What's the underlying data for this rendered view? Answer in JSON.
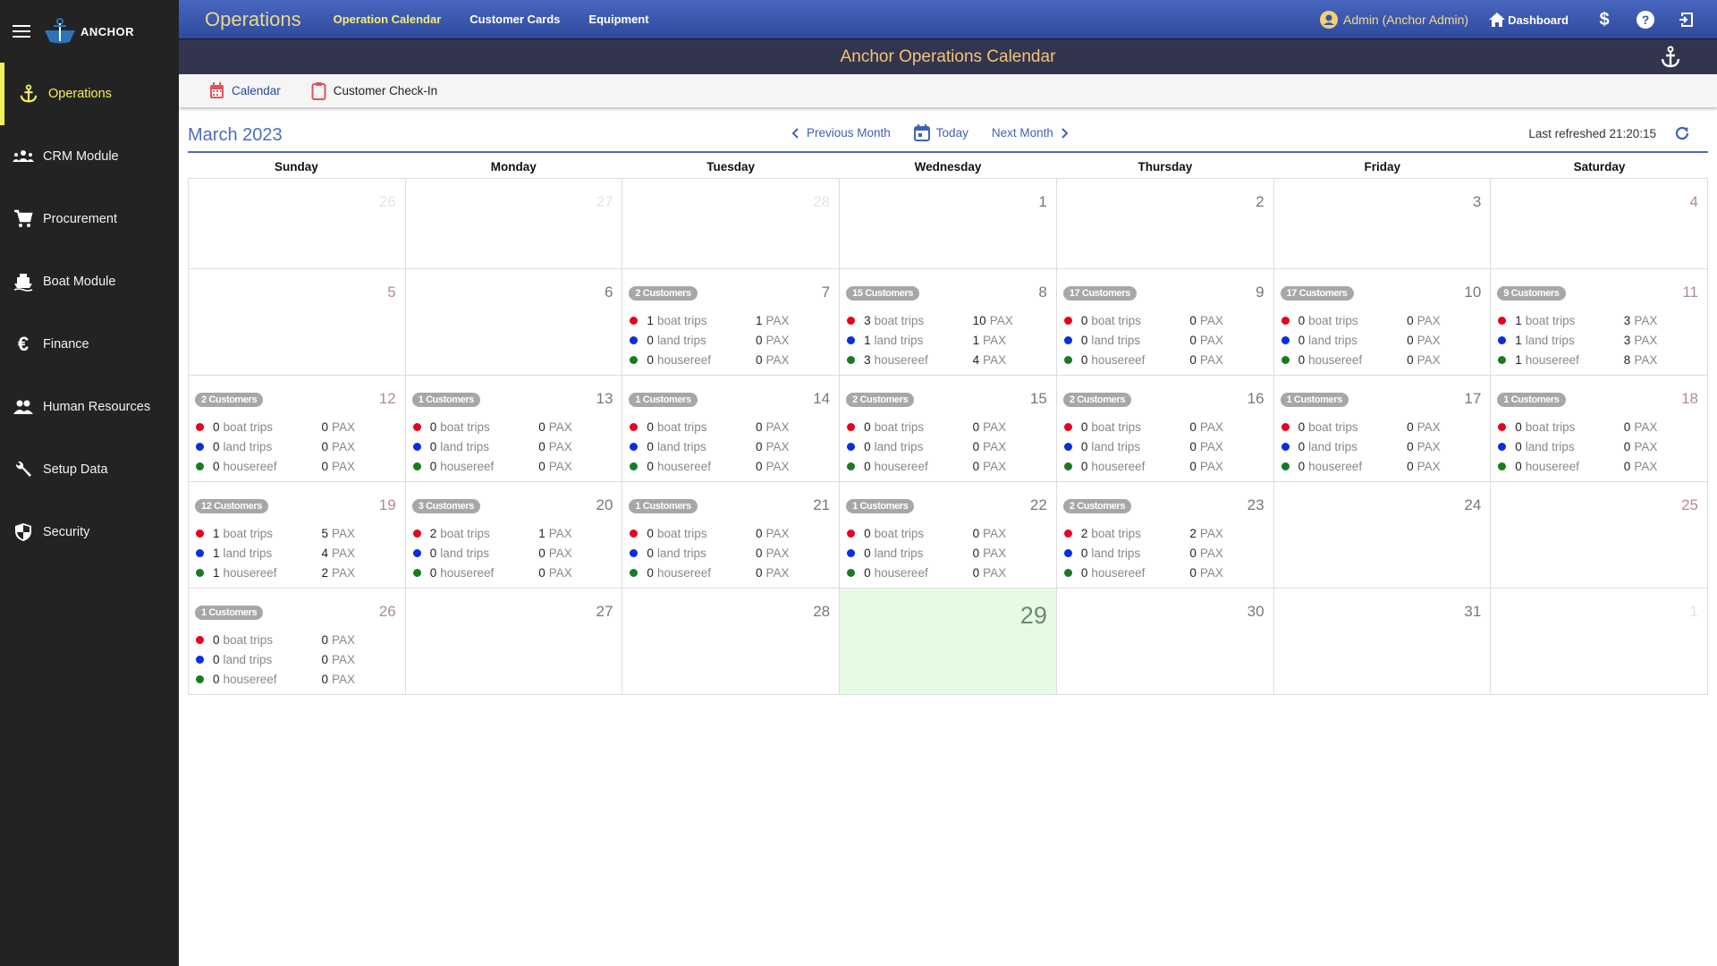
{
  "sidebar": {
    "logo_text": "ANCHOR",
    "items": [
      {
        "label": "Operations",
        "icon": "anchor-icon",
        "active": true
      },
      {
        "label": "CRM Module",
        "icon": "groups-icon"
      },
      {
        "label": "Procurement",
        "icon": "cart-icon"
      },
      {
        "label": "Boat Module",
        "icon": "boat-icon"
      },
      {
        "label": "Finance",
        "icon": "euro-icon"
      },
      {
        "label": "Human Resources",
        "icon": "people-icon"
      },
      {
        "label": "Setup Data",
        "icon": "wrench-icon"
      },
      {
        "label": "Security",
        "icon": "shield-icon"
      }
    ]
  },
  "topbar": {
    "title": "Operations",
    "links": [
      "Operation Calendar",
      "Customer Cards",
      "Equipment"
    ],
    "user": "Admin (Anchor Admin)",
    "dashboard": "Dashboard"
  },
  "subbar": {
    "title": "Anchor Operations Calendar"
  },
  "tabs": [
    "Calendar",
    "Customer Check-In"
  ],
  "calendar": {
    "month_label": "March 2023",
    "prev": "Previous Month",
    "today": "Today",
    "next": "Next Month",
    "refreshed": "Last refreshed 21:20:15",
    "weekdays": [
      "Sunday",
      "Monday",
      "Tuesday",
      "Wednesday",
      "Thursday",
      "Friday",
      "Saturday"
    ],
    "stat_labels": [
      "boat trips",
      "land trips",
      "housereef"
    ],
    "pax_label": "PAX",
    "dot_colors": [
      "#e8001c",
      "#0a2de0",
      "#1a7a22"
    ],
    "weeks": [
      [
        {
          "day": "26",
          "other": true,
          "weekend": true
        },
        {
          "day": "27",
          "other": true
        },
        {
          "day": "28",
          "other": true
        },
        {
          "day": "1"
        },
        {
          "day": "2"
        },
        {
          "day": "3"
        },
        {
          "day": "4",
          "weekend": true
        }
      ],
      [
        {
          "day": "5",
          "weekend": true
        },
        {
          "day": "6"
        },
        {
          "day": "7",
          "customers": "2 Customers",
          "stats": [
            [
              1,
              1
            ],
            [
              0,
              0
            ],
            [
              0,
              0
            ]
          ]
        },
        {
          "day": "8",
          "customers": "15 Customers",
          "stats": [
            [
              3,
              10
            ],
            [
              1,
              1
            ],
            [
              3,
              4
            ]
          ]
        },
        {
          "day": "9",
          "customers": "17 Customers",
          "stats": [
            [
              0,
              0
            ],
            [
              0,
              0
            ],
            [
              0,
              0
            ]
          ]
        },
        {
          "day": "10",
          "customers": "17 Customers",
          "stats": [
            [
              0,
              0
            ],
            [
              0,
              0
            ],
            [
              0,
              0
            ]
          ]
        },
        {
          "day": "11",
          "weekend": true,
          "customers": "9 Customers",
          "stats": [
            [
              1,
              3
            ],
            [
              1,
              3
            ],
            [
              1,
              8
            ]
          ]
        }
      ],
      [
        {
          "day": "12",
          "weekend": true,
          "customers": "2 Customers",
          "stats": [
            [
              0,
              0
            ],
            [
              0,
              0
            ],
            [
              0,
              0
            ]
          ]
        },
        {
          "day": "13",
          "customers": "1 Customers",
          "stats": [
            [
              0,
              0
            ],
            [
              0,
              0
            ],
            [
              0,
              0
            ]
          ]
        },
        {
          "day": "14",
          "customers": "1 Customers",
          "stats": [
            [
              0,
              0
            ],
            [
              0,
              0
            ],
            [
              0,
              0
            ]
          ]
        },
        {
          "day": "15",
          "customers": "2 Customers",
          "stats": [
            [
              0,
              0
            ],
            [
              0,
              0
            ],
            [
              0,
              0
            ]
          ]
        },
        {
          "day": "16",
          "customers": "2 Customers",
          "stats": [
            [
              0,
              0
            ],
            [
              0,
              0
            ],
            [
              0,
              0
            ]
          ]
        },
        {
          "day": "17",
          "customers": "1 Customers",
          "stats": [
            [
              0,
              0
            ],
            [
              0,
              0
            ],
            [
              0,
              0
            ]
          ]
        },
        {
          "day": "18",
          "weekend": true,
          "customers": "1 Customers",
          "stats": [
            [
              0,
              0
            ],
            [
              0,
              0
            ],
            [
              0,
              0
            ]
          ]
        }
      ],
      [
        {
          "day": "19",
          "weekend": true,
          "customers": "12 Customers",
          "stats": [
            [
              1,
              5
            ],
            [
              1,
              4
            ],
            [
              1,
              2
            ]
          ]
        },
        {
          "day": "20",
          "customers": "3 Customers",
          "stats": [
            [
              2,
              1
            ],
            [
              0,
              0
            ],
            [
              0,
              0
            ]
          ]
        },
        {
          "day": "21",
          "customers": "1 Customers",
          "stats": [
            [
              0,
              0
            ],
            [
              0,
              0
            ],
            [
              0,
              0
            ]
          ]
        },
        {
          "day": "22",
          "customers": "1 Customers",
          "stats": [
            [
              0,
              0
            ],
            [
              0,
              0
            ],
            [
              0,
              0
            ]
          ]
        },
        {
          "day": "23",
          "customers": "2 Customers",
          "stats": [
            [
              2,
              2
            ],
            [
              0,
              0
            ],
            [
              0,
              0
            ]
          ]
        },
        {
          "day": "24"
        },
        {
          "day": "25",
          "weekend": true
        }
      ],
      [
        {
          "day": "26",
          "weekend": true,
          "customers": "1 Customers",
          "stats": [
            [
              0,
              0
            ],
            [
              0,
              0
            ],
            [
              0,
              0
            ]
          ]
        },
        {
          "day": "27"
        },
        {
          "day": "28"
        },
        {
          "day": "29",
          "today": true
        },
        {
          "day": "30"
        },
        {
          "day": "31"
        },
        {
          "day": "1",
          "other": true,
          "weekend": true
        }
      ]
    ]
  }
}
